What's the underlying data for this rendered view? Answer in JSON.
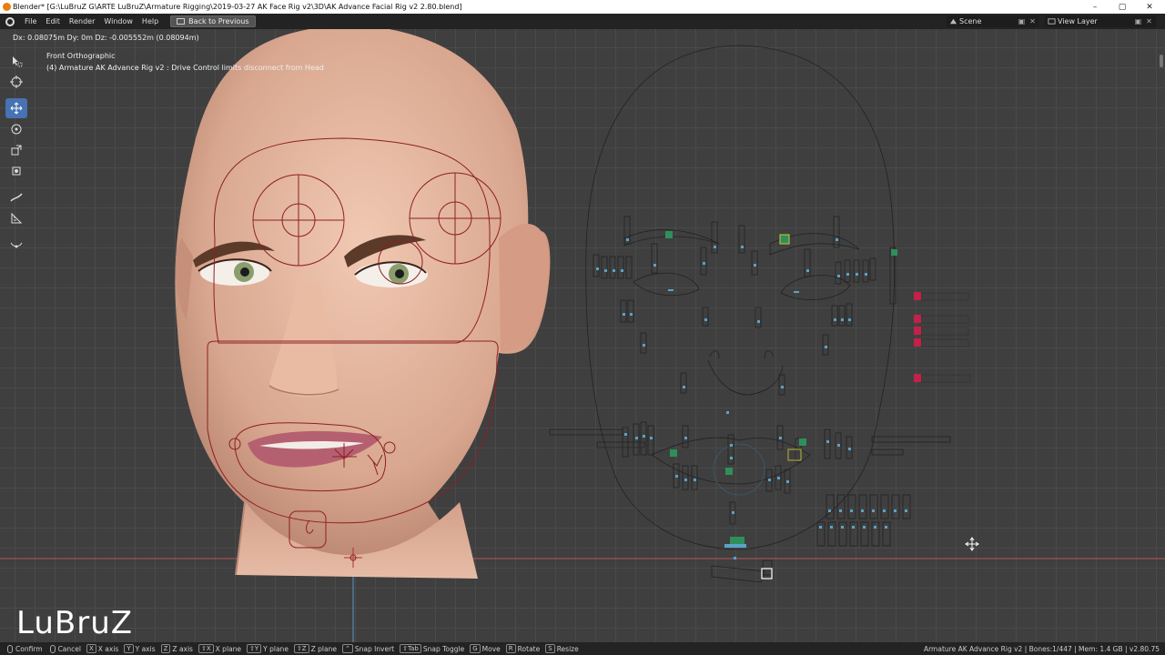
{
  "window": {
    "title": "Blender* [G:\\LuBruZ G\\ARTE LuBruZ\\Armature Rigging\\2019-03-27 AK Face Rig v2\\3D\\AK Advance Facial Rig v2 2.80.blend]",
    "minimize": "–",
    "maximize": "▢",
    "close": "✕"
  },
  "menubar": {
    "items": [
      "File",
      "Edit",
      "Render",
      "Window",
      "Help"
    ],
    "back_button": "Back to Previous",
    "scene": "Scene",
    "view_layer": "View Layer"
  },
  "viewport": {
    "delta_readout": "Dx: 0.08075m  Dy: 0m  Dz: -0.005552m (0.08094m)",
    "view_name": "Front Orthographic",
    "object_info": "(4) Armature AK Advance Rig v2 : Drive Control limits disconnect from Head",
    "watermark": "LuBruZ",
    "tools": [
      "select-box-icon",
      "cursor-icon",
      "move-icon",
      "rotate-icon",
      "scale-icon",
      "transform-icon",
      "annotate-icon",
      "measure-icon",
      "edge-slide-icon"
    ],
    "colors": {
      "background": "#3f3f3f",
      "grid": "#4a4a4a",
      "active_tool": "#4772b3",
      "bone_outline": "#8e1f24",
      "selected_bone": "#2f8f5a",
      "control_red": "#c4204a",
      "axis_x": "#c7565f",
      "axis_y": "#6ea6d6"
    }
  },
  "statusbar": {
    "items": [
      {
        "key": "mouse",
        "label": "Confirm"
      },
      {
        "key": "mouse",
        "label": "Cancel"
      },
      {
        "key": "X",
        "label": "X axis"
      },
      {
        "key": "Y",
        "label": "Y axis"
      },
      {
        "key": "Z",
        "label": "Z axis"
      },
      {
        "key": "⇧X",
        "label": "X plane"
      },
      {
        "key": "⇧Y",
        "label": "Y plane"
      },
      {
        "key": "⇧Z",
        "label": "Z plane"
      },
      {
        "key": "⌃",
        "label": "Snap Invert"
      },
      {
        "key": "⇧Tab",
        "label": "Snap Toggle"
      },
      {
        "key": "G",
        "label": "Move"
      },
      {
        "key": "R",
        "label": "Rotate"
      },
      {
        "key": "S",
        "label": "Resize"
      }
    ],
    "right_info": "Armature AK Advance Rig v2 | Bones:1/447 | Mem: 1.4 GB | v2.80.75"
  }
}
